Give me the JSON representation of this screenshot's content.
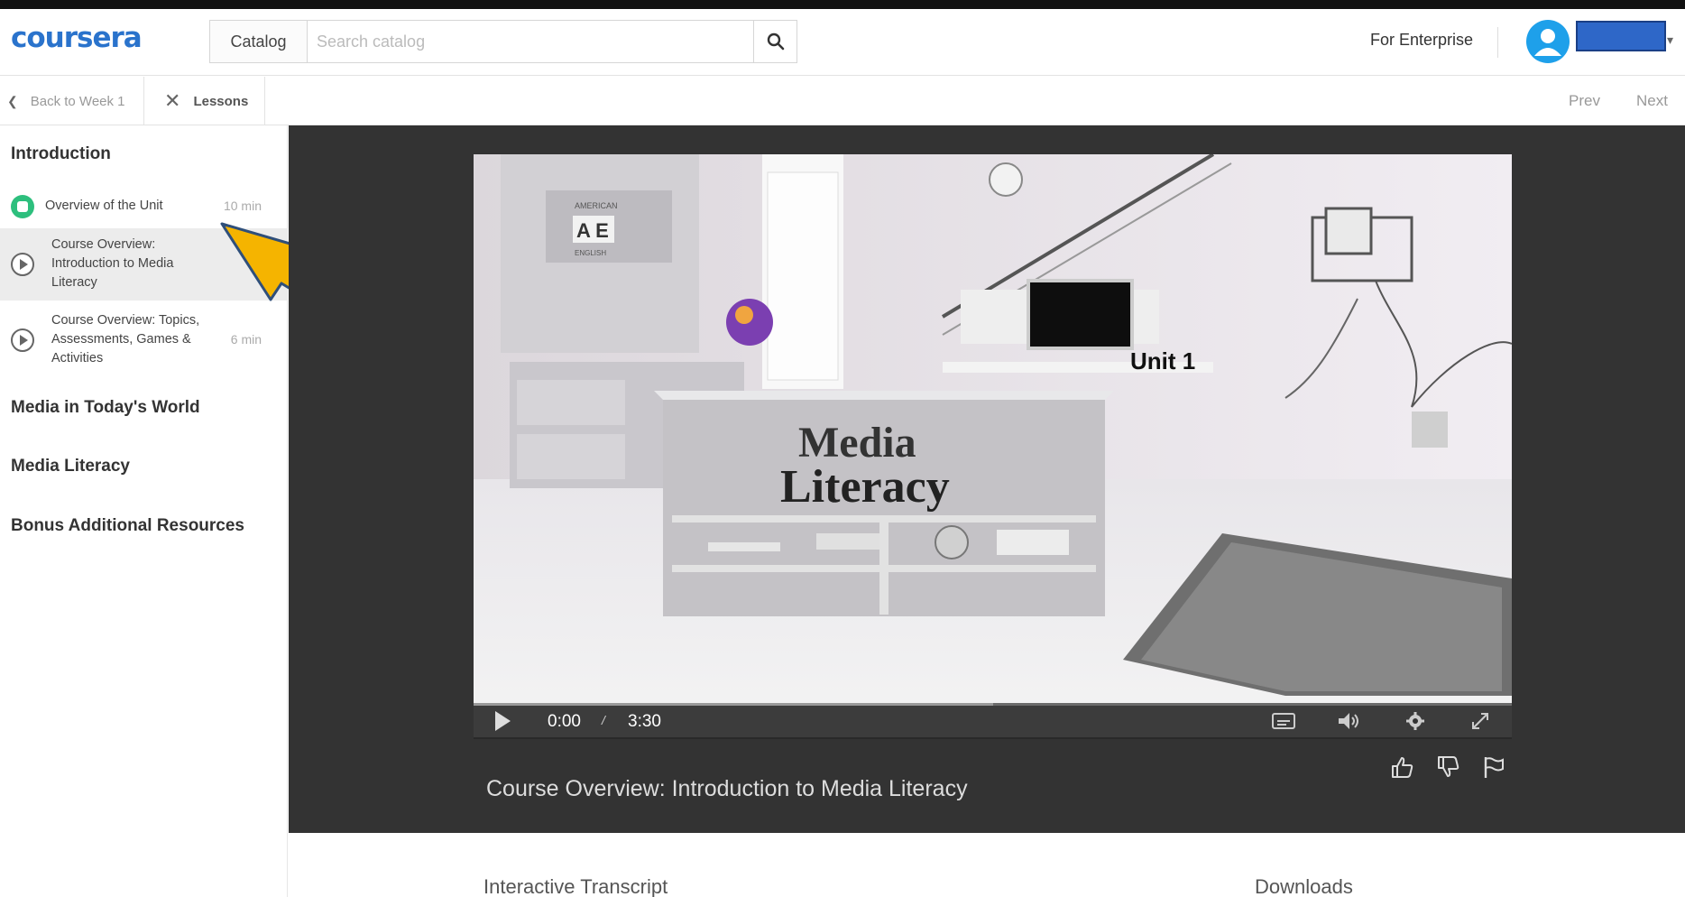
{
  "brand": {
    "logo_text": "coursera",
    "accent": "#2a73cc"
  },
  "header": {
    "catalog_label": "Catalog",
    "search_placeholder": "Search catalog",
    "search_icon": "search-icon",
    "enterprise_label": "For Enterprise",
    "avatar_icon": "user-avatar-icon",
    "avatar_color": "#1ea0ea"
  },
  "subnav": {
    "back_label": "Back to Week 1",
    "lessons_label": "Lessons",
    "prev_label": "Prev",
    "next_label": "Next"
  },
  "sidebar": {
    "modules": [
      {
        "title": "Introduction"
      },
      {
        "title": "Media in Today's World"
      },
      {
        "title": "Media Literacy"
      },
      {
        "title": "Bonus Additional Resources"
      }
    ],
    "lessons": [
      {
        "title": "Overview of the Unit",
        "duration": "10 min",
        "status": "completed",
        "status_color": "#2dbf7d"
      },
      {
        "title": "Course Overview: Introduction to Media Literacy",
        "duration": "",
        "status": "current"
      },
      {
        "title": "Course Overview: Topics, Assessments, Games & Activities",
        "duration": "6 min",
        "status": "not-started"
      }
    ],
    "callout_arrow_color": "#f5b400"
  },
  "video": {
    "current_time": "0:00",
    "separator": "/",
    "duration": "3:30",
    "title": "Course Overview: Introduction to Media Literacy",
    "scene_text": {
      "shelf_top": "AMERICAN",
      "shelf_letters": "A E",
      "shelf_bottom": "ENGLISH",
      "unit_label": "Unit 1",
      "desk_line1": "Media",
      "desk_line2": "Literacy"
    },
    "controls": [
      "play-icon",
      "captions-icon",
      "volume-icon",
      "settings-icon",
      "fullscreen-icon"
    ]
  },
  "feedback": [
    "thumbs-up-icon",
    "thumbs-down-icon",
    "flag-icon"
  ],
  "bottom": {
    "transcript_label": "Interactive Transcript",
    "downloads_label": "Downloads"
  }
}
